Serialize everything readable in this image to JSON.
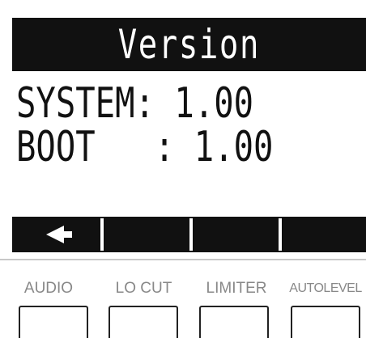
{
  "screen": {
    "title": "Version",
    "lines": [
      {
        "label": "SYSTEM:",
        "value": "1.00",
        "text": "SYSTEM: 1.00"
      },
      {
        "label": "BOOT  :",
        "value": "1.00",
        "text": "BOOT   : 1.00"
      }
    ],
    "softkeys": [
      {
        "icon": "back-arrow-icon"
      },
      {
        "icon": ""
      },
      {
        "icon": ""
      },
      {
        "icon": ""
      }
    ]
  },
  "hardware_buttons": [
    {
      "label": "AUDIO"
    },
    {
      "label": "LO CUT"
    },
    {
      "label": "LIMITER"
    },
    {
      "label": "AUTOLEVEL"
    }
  ],
  "colors": {
    "lcd_dark": "#111111",
    "lcd_light": "#ffffff",
    "label_gray": "#888888"
  }
}
